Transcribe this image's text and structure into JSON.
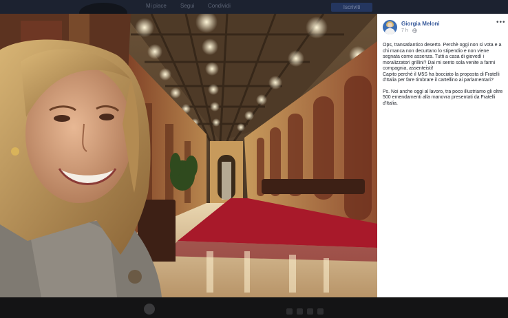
{
  "topbar": {
    "nav_items": [
      "Mi piace",
      "Segui",
      "Condividi"
    ],
    "cta_label": "Iscriviti",
    "search_hint": ""
  },
  "post": {
    "author": "Giorgia Meloni",
    "time": "7 h",
    "paragraph_1": "Ops, transatlantico deserto. Perchè oggi non si vota e a chi manca non decurtano lo stipendio e non viene segnata come assenza. Tutti a casa di giovedì i moralizzatori grillini? Dai mi sento sola venite a farmi compagnia, assenteisti!\nCapito perchè il M5S ha bocciato la proposta di Fratelli d'Italia per fare timbrare il cartellino ai parlamentari?",
    "paragraph_2": "Ps. Noi anche oggi al lavoro, tra poco illustriamo gli oltre 500 emendamenti alla manovra presentati da Fratelli d'Italia."
  },
  "colors": {
    "author_link": "#365899",
    "panel_bg": "#ffffff",
    "page_dim": "#101011"
  },
  "icons": [
    "more-options-icon",
    "globe-icon",
    "author-avatar"
  ]
}
